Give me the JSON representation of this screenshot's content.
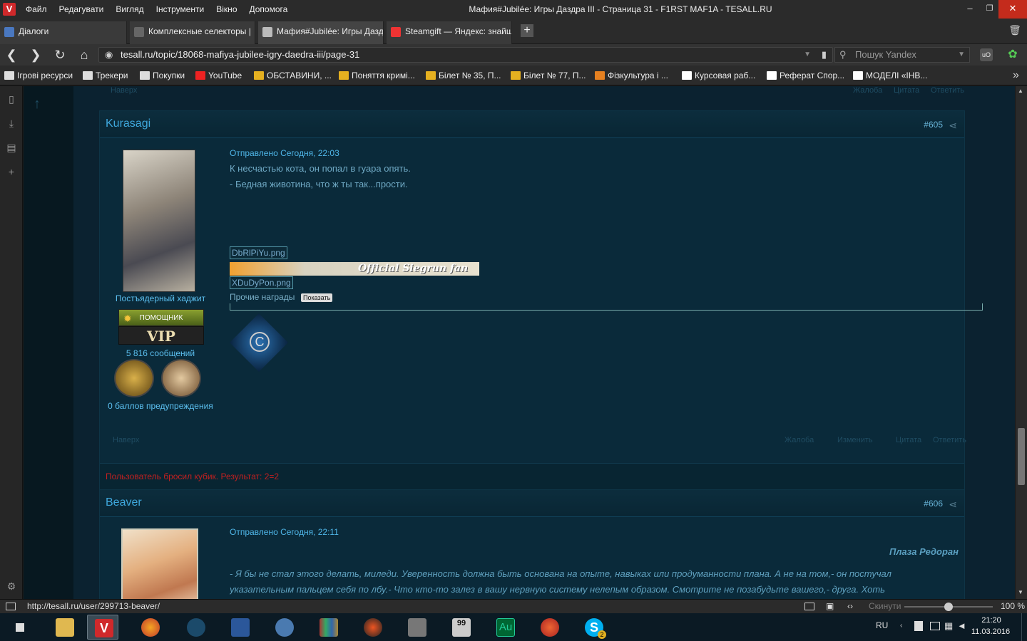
{
  "window": {
    "title": "Мафия#Jubilée: Игры Даздра III - Страница 31 - F1RST MAF1A - TESALL.RU",
    "logo": "V",
    "menu": [
      "Файл",
      "Редагувати",
      "Вигляд",
      "Інструменти",
      "Вікно",
      "Допомога"
    ],
    "controls": {
      "minimize": "–",
      "maximize": "❐",
      "close": "✕"
    }
  },
  "tabs": [
    {
      "label": "Діалоги",
      "icon": "pause-icon",
      "active": false
    },
    {
      "label": "Комплексные селекторы |",
      "icon": "page-icon",
      "active": false
    },
    {
      "label": "Мафия#Jubilée: Игры Дазд",
      "icon": "tesall-icon",
      "active": true
    },
    {
      "label": "Steamgift — Яндекс: знайш",
      "icon": "yandex-icon",
      "active": false
    }
  ],
  "tabbar": {
    "new_tab": "+",
    "trash": "🗑"
  },
  "address": {
    "url": "tesall.ru/topic/18068-mafiya-jubilee-igry-daedra-iii/page-31",
    "search_placeholder": "Пошук Yandex"
  },
  "bookmarks": [
    "Ігрові ресурси",
    "Трекери",
    "Покупки",
    "YouTube",
    "ОБСТАВИНИ, ...",
    "Поняття кримі...",
    "Білет № 35, П...",
    "Білет № 77, П...",
    "Фізкультура і ...",
    "Курсовая раб...",
    "Реферат Спор...",
    "МОДЕЛІ «ІНВ..."
  ],
  "bookmarks_more": "»",
  "top_footer": {
    "back_top": "Наверх",
    "complaint": "Жалоба",
    "quote": "Цитата",
    "reply": "Ответить"
  },
  "post605": {
    "author": "Kurasagi",
    "number": "#605",
    "date": "Отправлено Сегодня, 22:03",
    "lines": [
      "К несчастью кота, он попал в гуара опять.",
      "- Бедная животина, что ж ты так...прости."
    ],
    "img1": "DbRlPiYu.png",
    "banner": "Official Siegrun fan",
    "img2": "XDuDyPon.png",
    "awards_label": "Прочие награды",
    "show_btn": "Показать",
    "user_title": "Постъядерный хаджит",
    "rank1": "ПОМОЩНИК",
    "rank2": "VIP",
    "posts": "5 816 сообщений",
    "warnings": "0 баллов предупреждения",
    "footer": {
      "back_top": "Наверх",
      "complaint": "Жалоба",
      "edit": "Изменить",
      "quote": "Цитата",
      "reply": "Ответить"
    },
    "dice": "Пользователь бросил кубик. Результат: 2=2"
  },
  "post606": {
    "author": "Beaver",
    "number": "#606",
    "date": "Отправлено Сегодня, 22:11",
    "location": "Плаза Редоран",
    "line1": "- Я бы не стал этого делать, миледи. Уверенность должна быть основана на опыте, навыках или продуманности плана. А не на том,- он постучал",
    "line2": "указательным пальцем себя по лбу.- Что кто-то залез в вашу нервную систему нелепым образом. Смотрите не позабудьте вашего,- друга. Хоть"
  },
  "status": {
    "url": "http://tesall.ru/user/299713-beaver/",
    "reset": "Скинути",
    "zoom": "100 %",
    "zoom_level": 0.5
  },
  "taskbar": {
    "lang": "RU",
    "time": "21:20",
    "date": "11.03.2016",
    "apps": [
      "file-explorer",
      "vivaldi",
      "firefox",
      "steam",
      "word",
      "thunderbird",
      "library",
      "app-game",
      "app-tool",
      "app-99",
      "audition",
      "ccleaner",
      "skype"
    ],
    "audition_label": "Au",
    "app99_label": "99",
    "skype_badge": "2"
  }
}
